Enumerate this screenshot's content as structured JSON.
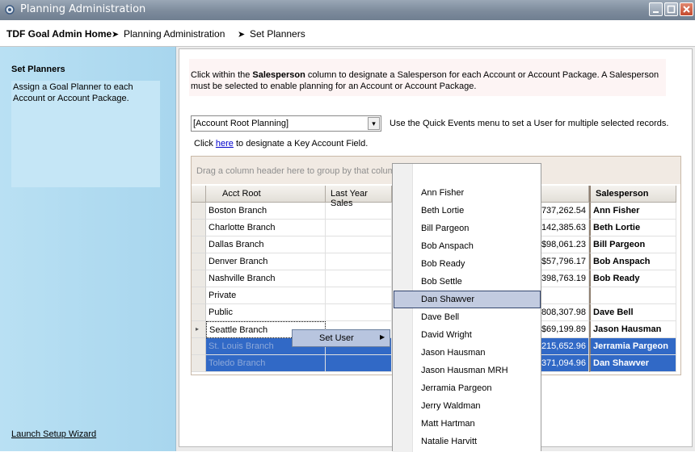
{
  "window": {
    "title": "Planning Administration"
  },
  "breadcrumb": {
    "home": "TDF Goal Admin Home",
    "arrow": "➤",
    "level1": "Planning Administration",
    "level2": "Set Planners"
  },
  "sidebar": {
    "title": "Set Planners",
    "description": "Assign a Goal Planner to each Account or Account Package.",
    "wizard_link": "Launch Setup Wizard"
  },
  "notice": {
    "pre": "Click within the ",
    "bold": "Salesperson",
    "post": " column to designate a Salesperson for each Account or Account Package.  A Salesperson must be selected to enable planning for an Account or Account Package."
  },
  "filter": {
    "selected": "[Account Root Planning]",
    "arrow": "▾"
  },
  "quick_note": "Use the Quick Events menu to set a User for multiple selected records.",
  "key_note": {
    "pre": "Click ",
    "link": "here",
    "post": " to designate a Key Account Field."
  },
  "grid": {
    "group_hint": "Drag a column header here to group by that column",
    "columns": {
      "root": "Acct Root",
      "lys": "Last Year Sales",
      "salesperson": "Salesperson"
    },
    "rows": [
      {
        "root": "Boston Branch",
        "sales": "737,262.54",
        "sp": "Ann Fisher"
      },
      {
        "root": "Charlotte Branch",
        "sales": "142,385.63",
        "sp": "Beth Lortie"
      },
      {
        "root": "Dallas Branch",
        "sales": "$98,061.23",
        "sp": "Bill Pargeon"
      },
      {
        "root": "Denver Branch",
        "sales": "$57,796.17",
        "sp": "Bob Anspach"
      },
      {
        "root": "Nashville Branch",
        "sales": "398,763.19",
        "sp": "Bob Ready"
      },
      {
        "root": "Private",
        "sales": "",
        "sp": ""
      },
      {
        "root": "Public",
        "sales": "808,307.98",
        "sp": "Dave Bell"
      },
      {
        "root": "Seattle Branch",
        "sales": "$69,199.89",
        "sp": "Jason Hausman",
        "marker": "▸"
      },
      {
        "root": "St. Louis Branch",
        "sales": "215,652.96",
        "sp": "Jerramia Pargeon"
      },
      {
        "root": "Toledo Branch",
        "sales": "371,094.96",
        "sp": "Dan Shawver"
      }
    ]
  },
  "context_menu": {
    "label": "Set User",
    "arrow": "▶"
  },
  "user_menu": {
    "highlighted": "Dan Shawver",
    "items": [
      "Ann Fisher",
      "Beth Lortie",
      "Bill Pargeon",
      "Bob Anspach",
      "Bob Ready",
      "Bob Settle",
      "Dan Shawver",
      "Dave Bell",
      "David Wright",
      "Jason Hausman",
      "Jason Hausman MRH",
      "Jerramia Pargeon",
      "Jerry Waldman",
      "Matt Hartman",
      "Natalie Harvitt"
    ]
  },
  "colors": {
    "selection": "#3169c6",
    "sidebar": "#b9e0f3",
    "menu_highlight": "#c2cbe0"
  }
}
